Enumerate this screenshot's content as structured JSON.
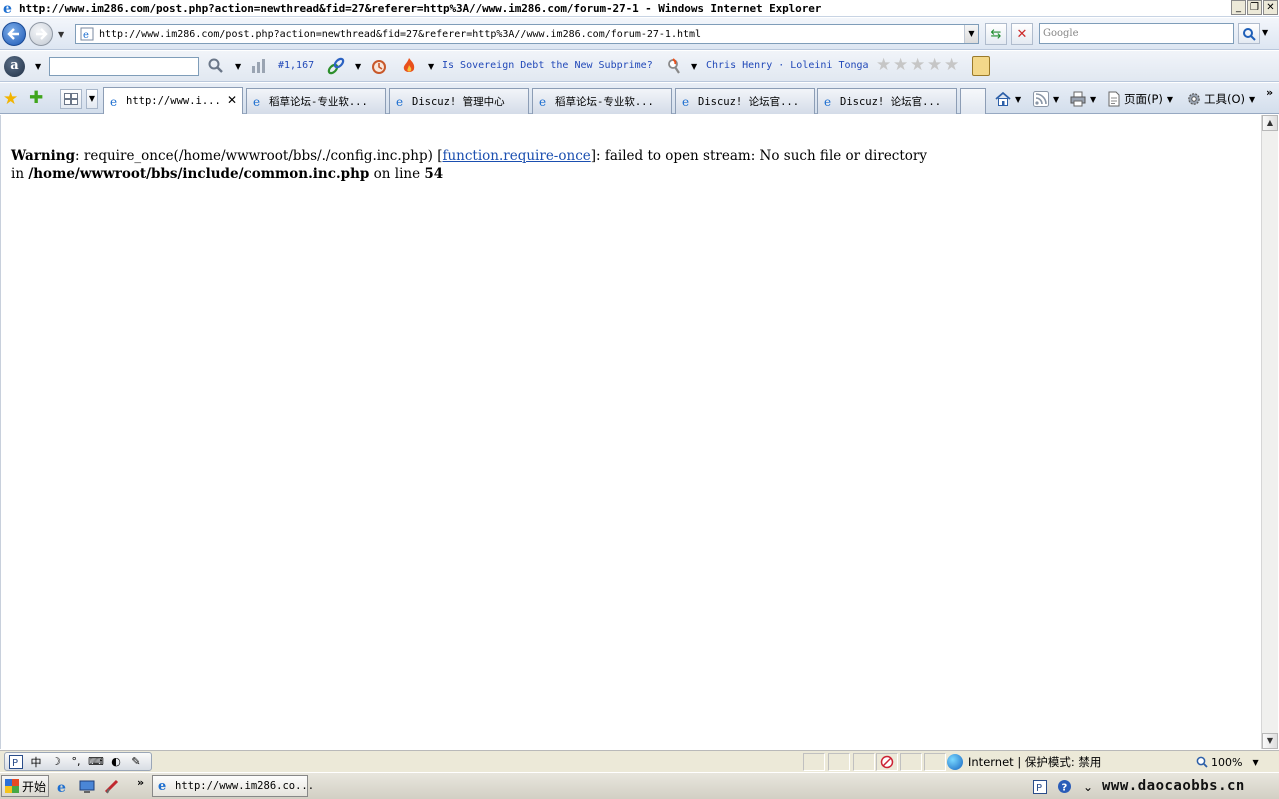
{
  "window": {
    "title": "http://www.im286.com/post.php?action=newthread&fid=27&referer=http%3A//www.im286.com/forum-27-1 - Windows Internet Explorer",
    "controls": [
      "minimize",
      "restore",
      "close"
    ]
  },
  "address_bar": {
    "url": "http://www.im286.com/post.php?action=newthread&fid=27&referer=http%3A//www.im286.com/forum-27-1.html"
  },
  "search": {
    "placeholder": "Google"
  },
  "alexa_toolbar": {
    "search_value": "",
    "rank": "#1,167",
    "headline": "Is Sovereign Debt the New Subprime?",
    "people": "Chris Henry · Loleini Tonga",
    "rating_stars": 5
  },
  "tabs": [
    {
      "label": "http://www.i...",
      "active": true
    },
    {
      "label": "稻草论坛-专业软...",
      "active": false
    },
    {
      "label": "Discuz! 管理中心",
      "active": false
    },
    {
      "label": "稻草论坛-专业软...",
      "active": false
    },
    {
      "label": "Discuz! 论坛官...",
      "active": false
    },
    {
      "label": "Discuz! 论坛官...",
      "active": false
    }
  ],
  "commands": {
    "page": "页面(P)",
    "tools": "工具(O)"
  },
  "content": {
    "warning_label": "Warning",
    "warning_msg": "require_once(/home/wwwroot/bbs/./config.inc.php) [",
    "warning_link": "function.require-once",
    "warning_msg2": "]: failed to open stream: No such file or directory",
    "in_label": "in",
    "file_path": "/home/wwwroot/bbs/include/common.inc.php",
    "on_line_label": "on line",
    "line_number": "54"
  },
  "status_bar": {
    "zone": "Internet | 保护模式: 禁用",
    "zoom": "100%"
  },
  "taskbar": {
    "start": "开始",
    "ie_task": "http://www.im286.co...",
    "watermark": "www.daocaobbs.cn"
  },
  "colors": {
    "link": "#1b4fb0",
    "toolbar_link": "#2249b8"
  }
}
